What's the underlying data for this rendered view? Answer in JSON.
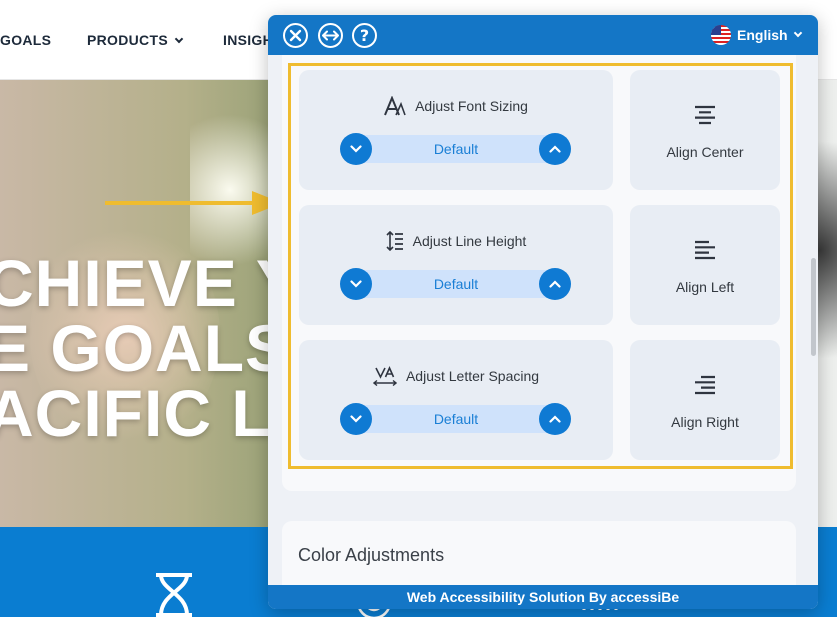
{
  "site": {
    "nav": {
      "goals": "GOALS",
      "products": "PRODUCTS",
      "insights": "INSIGH"
    },
    "hero": {
      "line1": "CHIEVE Y",
      "line2": "E GOALS",
      "line3": "ACIFIC L"
    }
  },
  "widget": {
    "header": {
      "language": "English",
      "close_icon": "close-icon",
      "move_icon": "arrows-horizontal-icon",
      "help_icon": "help-icon"
    },
    "adjusters": [
      {
        "label": "Adjust Font Sizing",
        "value": "Default",
        "icon": "font-size-icon"
      },
      {
        "label": "Adjust Line Height",
        "value": "Default",
        "icon": "line-height-icon"
      },
      {
        "label": "Adjust Letter Spacing",
        "value": "Default",
        "icon": "letter-spacing-icon"
      }
    ],
    "alignments": [
      {
        "label": "Align Center",
        "icon": "align-center-icon"
      },
      {
        "label": "Align Left",
        "icon": "align-left-icon"
      },
      {
        "label": "Align Right",
        "icon": "align-right-icon"
      }
    ],
    "color_section": {
      "title": "Color Adjustments"
    },
    "footer": "Web Accessibility Solution By accessiBe"
  },
  "colors": {
    "widget_blue": "#1476c6",
    "highlight": "#efbc2f",
    "stepper_button": "#0f7ad3",
    "stepper_track": "#cfe2fb",
    "site_band": "#0a7dd1"
  }
}
